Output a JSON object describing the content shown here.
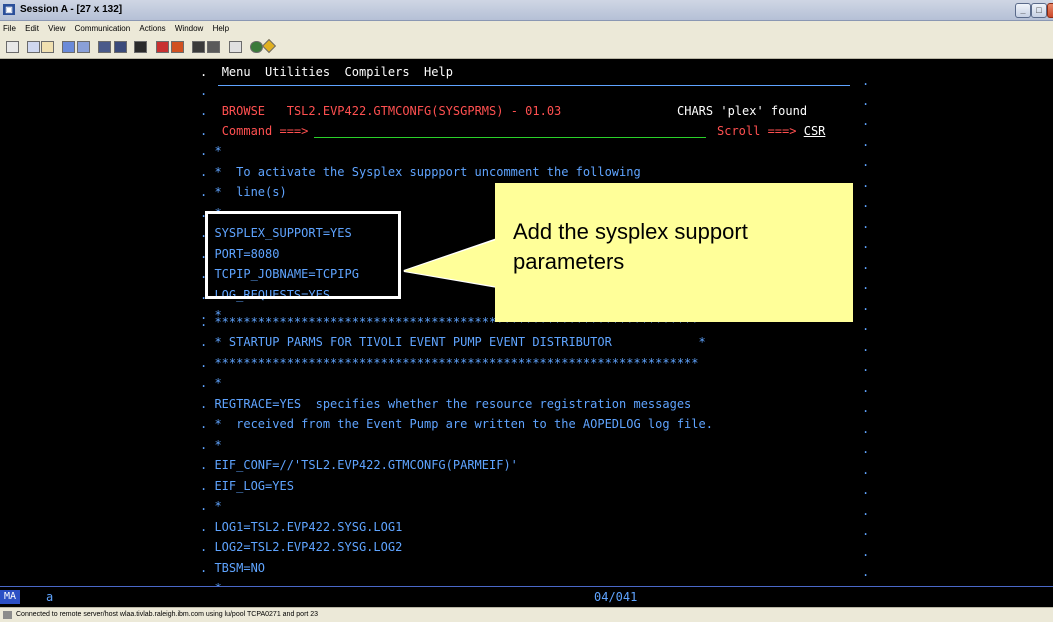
{
  "window": {
    "title": "Session A - [27 x 132]",
    "controls": [
      "minimize",
      "maximize",
      "close"
    ]
  },
  "menubar": [
    "File",
    "Edit",
    "View",
    "Communication",
    "Actions",
    "Window",
    "Help"
  ],
  "toolbar": {
    "icons": [
      "print-screen-icon",
      "copy-icon",
      "paste-icon",
      "send-file-icon",
      "receive-file-icon",
      "display-keypad-icon",
      "color-map-icon",
      "record-macro-icon",
      "play-macro-icon",
      "stop-macro-icon",
      "customize-icon",
      "help-icon",
      "support-icon"
    ]
  },
  "ispf": {
    "menu": [
      "Menu",
      "Utilities",
      "Compilers",
      "Help"
    ],
    "browse_label": "BROWSE",
    "dataset": "TSL2.EVP422.GTMCONFG(SYSGPRMS) - 01.03",
    "message": "CHARS 'plex' found",
    "command_label": "Command ===>",
    "scroll_label": "Scroll ===>",
    "scroll_value": "CSR"
  },
  "lines": [
    "*",
    "*  To activate the Sysplex suppport uncomment the following",
    "*  line(s)",
    "*",
    "SYSPLEX_SUPPORT=YES",
    "PORT=8080",
    "TCPIP_JOBNAME=TCPIPG",
    "LOG_REQUESTS=YES",
    "*",
    "*******************************************************************",
    "* STARTUP PARMS FOR TIVOLI EVENT PUMP EVENT DISTRIBUTOR            *",
    "*******************************************************************",
    "*",
    "REGTRACE=YES  specifies whether the resource registration messages",
    "*  received from the Event Pump are written to the AOPEDLOG log file.",
    "*",
    "EIF_CONF=//'TSL2.EVP422.GTMCONFG(PARMEIF)'",
    "EIF_LOG=YES",
    "*",
    "LOG1=TSL2.EVP422.SYSG.LOG1",
    "LOG2=TSL2.EVP422.SYSG.LOG2",
    "TBSM=NO",
    "*"
  ],
  "callout": {
    "text_line1": "Add the sysplex support",
    "text_line2": "parameters"
  },
  "status": {
    "indicator": "MA",
    "mode": "a",
    "cursor_position": "04/041"
  },
  "connection_status": "Connected to remote server/host wlaa.tivlab.raleigh.ibm.com using lu/pool TCPA0271 and port 23"
}
